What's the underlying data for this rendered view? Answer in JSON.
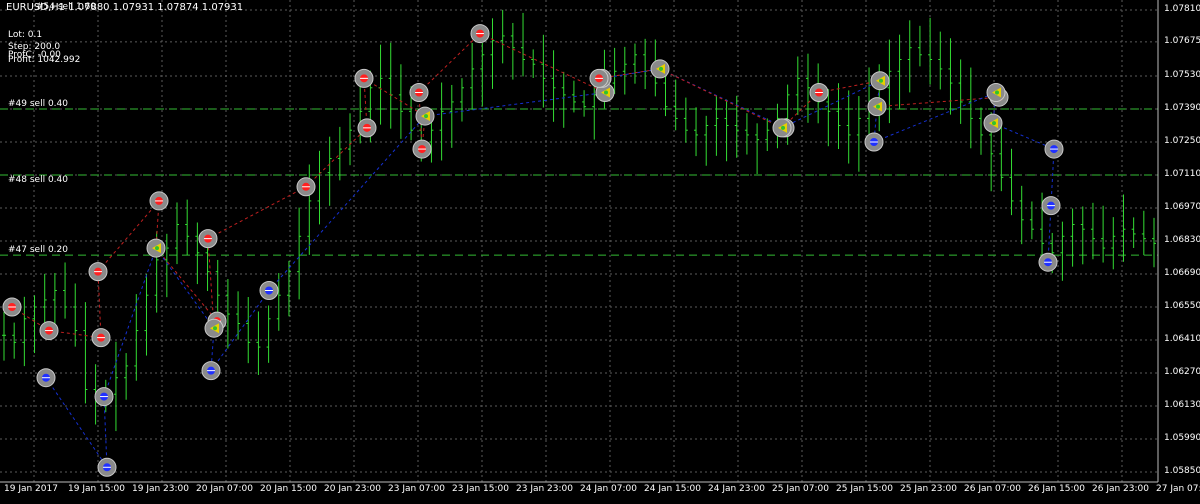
{
  "header": {
    "ohlc_text": "EURUSD,H1  1.07880 1.07931 1.07874 1.07931",
    "overlay_tag": "#54 sell 1.60"
  },
  "info_panel": {
    "lot": "Lot: 0.1",
    "step": "Step: 200.0",
    "prof_c": "ProfC: -0.00",
    "profit": "Profit: 1042.992"
  },
  "price_axis": {
    "labels": [
      "1.07810",
      "1.07675",
      "1.07530",
      "1.07390",
      "1.07250",
      "1.07110",
      "1.06970",
      "1.06830",
      "1.06690",
      "1.06550",
      "1.06410",
      "1.06270",
      "1.06130",
      "1.05990",
      "1.05850"
    ]
  },
  "time_axis": {
    "labels": [
      "19 Jan 2017",
      "19 Jan 15:00",
      "19 Jan 23:00",
      "20 Jan 07:00",
      "20 Jan 15:00",
      "20 Jan 23:00",
      "23 Jan 07:00",
      "23 Jan 15:00",
      "23 Jan 23:00",
      "24 Jan 07:00",
      "24 Jan 15:00",
      "24 Jan 23:00",
      "25 Jan 07:00",
      "25 Jan 15:00",
      "25 Jan 23:00",
      "26 Jan 07:00",
      "26 Jan 15:00",
      "26 Jan 23:00",
      "27 Jan 07:00"
    ]
  },
  "levels": [
    {
      "label": "#49 sell 0.40",
      "price": 1.0739
    },
    {
      "label": "#48 sell 0.40",
      "price": 1.0711
    },
    {
      "label": "#47 sell 0.20",
      "price": 1.0677
    }
  ],
  "colors": {
    "background": "#000000",
    "grid": "#5c5c5c",
    "candle": "#33dd33",
    "level_line": "#33bb33",
    "buy_marker": "#2030ff",
    "sell_marker": "#ff2020",
    "close_marker": "#e8d000",
    "buy_trend": "#1530d0",
    "sell_trend": "#c02020",
    "text": "#ffffff"
  },
  "chart_data": {
    "type": "candlestick",
    "symbol": "EURUSD",
    "timeframe": "H1",
    "ylim": [
      1.0585,
      1.0781
    ],
    "x": [
      "19 Jan 2017",
      "19 Jan 15:00",
      "19 Jan 23:00",
      "20 Jan 07:00",
      "20 Jan 15:00",
      "20 Jan 23:00",
      "23 Jan 07:00",
      "23 Jan 15:00",
      "23 Jan 23:00",
      "24 Jan 07:00",
      "24 Jan 15:00",
      "24 Jan 23:00",
      "25 Jan 07:00",
      "25 Jan 15:00",
      "25 Jan 23:00",
      "26 Jan 07:00",
      "26 Jan 15:00",
      "26 Jan 23:00",
      "27 Jan 07:00"
    ],
    "close_trace": [
      1.0643,
      1.064,
      1.065,
      1.0655,
      1.0658,
      1.0662,
      1.0655,
      1.0645,
      1.062,
      1.0615,
      1.0618,
      1.0625,
      1.063,
      1.0645,
      1.066,
      1.0675,
      1.068,
      1.069,
      1.0685,
      1.0678,
      1.067,
      1.066,
      1.0652,
      1.0648,
      1.064,
      1.0638,
      1.065,
      1.066,
      1.067,
      1.0685,
      1.07,
      1.0712,
      1.0718,
      1.0722,
      1.073,
      1.0738,
      1.0748,
      1.0752,
      1.0745,
      1.0738,
      1.073,
      1.0725,
      1.073,
      1.0738,
      1.0742,
      1.0748,
      1.0756,
      1.0762,
      1.0768,
      1.077,
      1.0765,
      1.076,
      1.0758,
      1.0752,
      1.0748,
      1.0745,
      1.0742,
      1.074,
      1.0745,
      1.075,
      1.0755,
      1.0758,
      1.0762,
      1.0755,
      1.075,
      1.074,
      1.0735,
      1.073,
      1.0728,
      1.0732,
      1.0735,
      1.0732,
      1.073,
      1.0728,
      1.0726,
      1.073,
      1.0735,
      1.0745,
      1.0752,
      1.0748,
      1.0742,
      1.0738,
      1.0732,
      1.0728,
      1.0735,
      1.0742,
      1.0748,
      1.0755,
      1.076,
      1.0765,
      1.0762,
      1.076,
      1.0756,
      1.075,
      1.0742,
      1.0735,
      1.0728,
      1.072,
      1.071,
      1.07,
      1.0692,
      1.0688,
      1.0682,
      1.0678,
      1.0685,
      1.069,
      1.0688,
      1.0684,
      1.068,
      1.0685,
      1.0688,
      1.0686,
      1.0684,
      1.0682
    ],
    "markers": [
      {
        "type": "sell",
        "time": "19 Jan 2017",
        "price": 1.0655
      },
      {
        "type": "sell",
        "time": "19 Jan 2017",
        "price": 1.0645
      },
      {
        "type": "buy",
        "time": "19 Jan 2017",
        "price": 1.0625
      },
      {
        "type": "buy",
        "time": "19 Jan 15:00",
        "price": 1.0587
      },
      {
        "type": "buy",
        "time": "19 Jan 15:00",
        "price": 1.0617
      },
      {
        "type": "sell",
        "time": "19 Jan 15:00",
        "price": 1.0642
      },
      {
        "type": "sell",
        "time": "19 Jan 15:00",
        "price": 1.067
      },
      {
        "type": "sell",
        "time": "19 Jan 23:00",
        "price": 1.07
      },
      {
        "type": "close",
        "time": "19 Jan 23:00",
        "price": 1.068
      },
      {
        "type": "sell",
        "time": "20 Jan 07:00",
        "price": 1.0649
      },
      {
        "type": "close",
        "time": "20 Jan 07:00",
        "price": 1.0646
      },
      {
        "type": "buy",
        "time": "20 Jan 07:00",
        "price": 1.0628
      },
      {
        "type": "sell",
        "time": "20 Jan 07:00",
        "price": 1.0684
      },
      {
        "type": "buy",
        "time": "20 Jan 15:00",
        "price": 1.0662
      },
      {
        "type": "sell",
        "time": "20 Jan 15:00",
        "price": 1.0706
      },
      {
        "type": "sell",
        "time": "20 Jan 23:00",
        "price": 1.0731
      },
      {
        "type": "sell",
        "time": "20 Jan 23:00",
        "price": 1.0752
      },
      {
        "type": "close",
        "time": "23 Jan 07:00",
        "price": 1.0736
      },
      {
        "type": "sell",
        "time": "23 Jan 07:00",
        "price": 1.0722
      },
      {
        "type": "sell",
        "time": "23 Jan 07:00",
        "price": 1.0746
      },
      {
        "type": "sell",
        "time": "23 Jan 15:00",
        "price": 1.0771
      },
      {
        "type": "close",
        "time": "24 Jan 07:00",
        "price": 1.0746
      },
      {
        "type": "buy",
        "time": "24 Jan 07:00",
        "price": 1.0752
      },
      {
        "type": "sell",
        "time": "24 Jan 07:00",
        "price": 1.0752
      },
      {
        "type": "close",
        "time": "24 Jan 15:00",
        "price": 1.0756
      },
      {
        "type": "buy",
        "time": "25 Jan 07:00",
        "price": 1.0731
      },
      {
        "type": "close",
        "time": "25 Jan 07:00",
        "price": 1.0731
      },
      {
        "type": "sell",
        "time": "25 Jan 07:00",
        "price": 1.0746
      },
      {
        "type": "close",
        "time": "25 Jan 15:00",
        "price": 1.0751
      },
      {
        "type": "close",
        "time": "25 Jan 15:00",
        "price": 1.074
      },
      {
        "type": "buy",
        "time": "25 Jan 15:00",
        "price": 1.0725
      },
      {
        "type": "sell",
        "time": "26 Jan 07:00",
        "price": 1.0744
      },
      {
        "type": "close",
        "time": "26 Jan 07:00",
        "price": 1.0746
      },
      {
        "type": "close",
        "time": "26 Jan 07:00",
        "price": 1.0733
      },
      {
        "type": "buy",
        "time": "26 Jan 15:00",
        "price": 1.0722
      },
      {
        "type": "buy",
        "time": "26 Jan 15:00",
        "price": 1.0698
      },
      {
        "type": "buy",
        "time": "26 Jan 15:00",
        "price": 1.0674
      }
    ]
  }
}
